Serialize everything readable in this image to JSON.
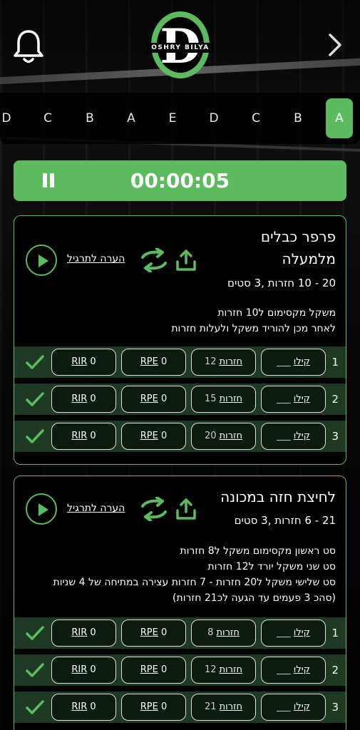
{
  "logo": {
    "letter": "D",
    "text": "OSHRY BILYA"
  },
  "day_tabs": [
    "D",
    "C",
    "B",
    "A",
    "E",
    "D",
    "C",
    "B",
    "A"
  ],
  "active_tab_index": 8,
  "timer": {
    "time": "00:00:05"
  },
  "exercises": [
    {
      "title_line1": "פרפר כבלים",
      "title_line2": "מלמעלה",
      "meta": "20 - 10 חזרות  ,3 סטים",
      "note_lines": [
        "משקל מקסימום ל10 חזרות",
        "לאחר מכן להוריד משקל ולעלות חזרות"
      ],
      "comment_label": "הערה לתרגיל",
      "sets": [
        {
          "num": "1",
          "kg_label": "קילו",
          "kg_value": "___",
          "reps_label": "חזרות",
          "reps_value": "12",
          "rpe_label": "RPE",
          "rpe_value": "0",
          "rir_label": "RIR",
          "rir_value": "0"
        },
        {
          "num": "2",
          "kg_label": "קילו",
          "kg_value": "___",
          "reps_label": "חזרות",
          "reps_value": "15",
          "rpe_label": "RPE",
          "rpe_value": "0",
          "rir_label": "RIR",
          "rir_value": "0"
        },
        {
          "num": "3",
          "kg_label": "קילו",
          "kg_value": "___",
          "reps_label": "חזרות",
          "reps_value": "20",
          "rpe_label": "RPE",
          "rpe_value": "0",
          "rir_label": "RIR",
          "rir_value": "0"
        }
      ]
    },
    {
      "title_line1": "לחיצת חזה במכונה",
      "meta": "21 - 6 חזרות  ,3 סטים",
      "note_lines": [
        "סט ראשון מקסימום משקל ל8 חזרות",
        "סט שני משקל יורד ל12 חזרות",
        "סט שלישי משקל ל20 חזרות - 7 חזרות עצירה במתיחה של 4 שניות",
        "(סהכ 3 פעמים עד הגעה לכ21 חזרות)"
      ],
      "comment_label": "הערה לתרגיל",
      "sets": [
        {
          "num": "1",
          "kg_label": "קילו",
          "kg_value": "___",
          "reps_label": "חזרות",
          "reps_value": "8",
          "rpe_label": "RPE",
          "rpe_value": "0",
          "rir_label": "RIR",
          "rir_value": "0"
        },
        {
          "num": "2",
          "kg_label": "קילו",
          "kg_value": "___",
          "reps_label": "חזרות",
          "reps_value": "12",
          "rpe_label": "RPE",
          "rpe_value": "0",
          "rir_label": "RIR",
          "rir_value": "0"
        },
        {
          "num": "3",
          "kg_label": "קילו",
          "kg_value": "___",
          "reps_label": "חזרות",
          "reps_value": "21",
          "rpe_label": "RPE",
          "rpe_value": "0",
          "rir_label": "RIR",
          "rir_value": "0"
        }
      ]
    }
  ],
  "colors": {
    "accent": "#5cbb5f",
    "row_bg": "#1f3a24",
    "card_bg": "#000000"
  },
  "icons": {
    "bell": "bell-icon",
    "next": "chevron-right-icon",
    "pause": "pause-icon",
    "play": "play-icon",
    "swap": "swap-icon",
    "share": "share-icon",
    "check": "check-icon"
  }
}
